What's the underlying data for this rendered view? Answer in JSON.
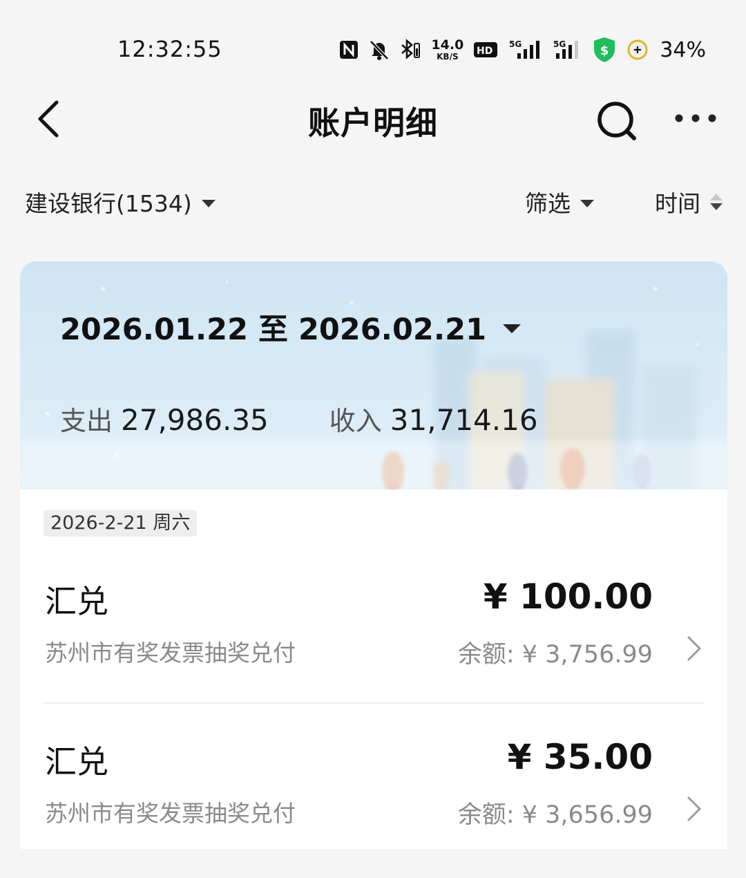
{
  "status_bar": {
    "time": "12:32:55",
    "net_speed_value": "14.0",
    "net_speed_unit": "KB/S",
    "battery": "34%",
    "icons": [
      "nfc-icon",
      "mute-icon",
      "bluetooth-battery-icon",
      "hd-icon",
      "signal-5g-icon",
      "signal-5g-icon",
      "security-shield-icon",
      "battery-saver-icon"
    ],
    "hd_label": "HD",
    "network_label": "5G",
    "shield_color": "#1ebe5a"
  },
  "header": {
    "title": "账户明细",
    "back_icon": "back-arrow-icon",
    "search_icon": "search-icon",
    "more_icon": "more-icon"
  },
  "filters": {
    "account": "建设银行(1534)",
    "filter_label": "筛选",
    "sort_label": "时间"
  },
  "summary": {
    "date_range": "2026.01.22 至 2026.02.21",
    "expense_label": "支出",
    "expense_value": "27,986.35",
    "income_label": "收入",
    "income_value": "31,714.16"
  },
  "transactions": {
    "date": "2026-2-21 周六",
    "items": [
      {
        "title": "汇兑",
        "amount": "¥ 100.00",
        "description": "苏州市有奖发票抽奖兑付",
        "balance": "余额: ¥ 3,756.99"
      },
      {
        "title": "汇兑",
        "amount": "¥ 35.00",
        "description": "苏州市有奖发票抽奖兑付",
        "balance": "余额: ¥ 3,656.99"
      }
    ]
  }
}
